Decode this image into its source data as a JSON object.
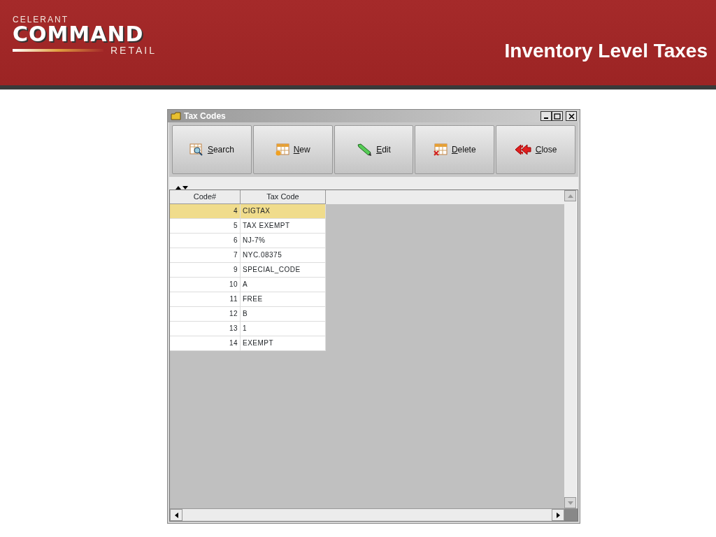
{
  "header": {
    "logo": {
      "brand": "CELERANT",
      "product": "COMMAND",
      "edition": "RETAIL"
    },
    "title": "Inventory Level Taxes"
  },
  "window": {
    "title": "Tax Codes"
  },
  "toolbar": [
    {
      "label": "Search",
      "kind": "search"
    },
    {
      "label": "New",
      "kind": "new"
    },
    {
      "label": "Edit",
      "kind": "edit"
    },
    {
      "label": "Delete",
      "kind": "delete"
    },
    {
      "label": "Close",
      "kind": "close"
    }
  ],
  "table": {
    "columns": [
      "Code#",
      "Tax Code"
    ],
    "rows": [
      {
        "code": "4",
        "tax_code": "CIGTAX",
        "selected": true
      },
      {
        "code": "5",
        "tax_code": "TAX EXEMPT",
        "selected": false
      },
      {
        "code": "6",
        "tax_code": "NJ-7%",
        "selected": false
      },
      {
        "code": "7",
        "tax_code": "NYC.08375",
        "selected": false
      },
      {
        "code": "9",
        "tax_code": "SPECIAL_CODE",
        "selected": false
      },
      {
        "code": "10",
        "tax_code": "A",
        "selected": false
      },
      {
        "code": "11",
        "tax_code": "FREE",
        "selected": false
      },
      {
        "code": "12",
        "tax_code": "B",
        "selected": false
      },
      {
        "code": "13",
        "tax_code": "1",
        "selected": false
      },
      {
        "code": "14",
        "tax_code": "EXEMPT",
        "selected": false
      }
    ]
  }
}
